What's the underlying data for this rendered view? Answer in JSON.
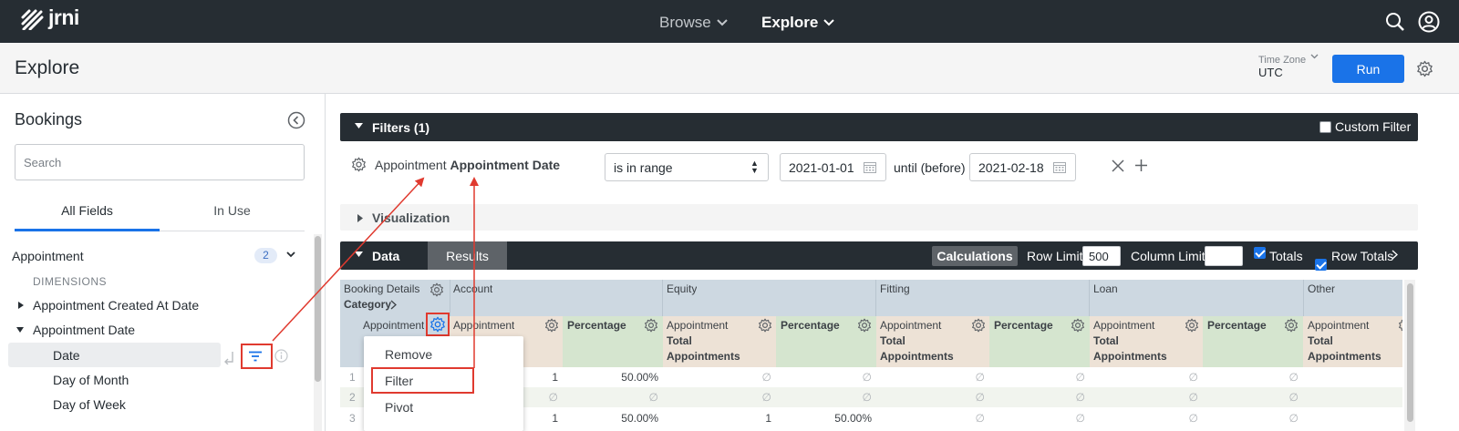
{
  "app": {
    "brand": "jrni",
    "nav": {
      "browse": "Browse",
      "explore": "Explore"
    }
  },
  "header": {
    "title": "Explore",
    "timezone_label": "Time Zone",
    "timezone_value": "UTC",
    "run_label": "Run"
  },
  "sidebar": {
    "title": "Bookings",
    "search_placeholder": "Search",
    "tabs": [
      "All Fields",
      "In Use"
    ],
    "group": {
      "name": "Appointment",
      "count": "2"
    },
    "dimensions_label": "DIMENSIONS",
    "fields": [
      "Appointment Created At Date",
      "Appointment Date",
      "Date",
      "Day of Month",
      "Day of Week"
    ]
  },
  "filters": {
    "title": "Filters (1)",
    "custom_filter_label": "Custom Filter",
    "field_prefix": "Appointment",
    "field_name": "Appointment Date",
    "operator": "is in range",
    "from_date": "2021-01-01",
    "until_label": "until (before)",
    "to_date": "2021-02-18"
  },
  "visualization": {
    "title": "Visualization"
  },
  "data": {
    "title": "Data",
    "results_tab": "Results",
    "calculations_label": "Calculations",
    "row_limit_label": "Row Limit",
    "row_limit_value": "500",
    "column_limit_label": "Column Limit",
    "totals_label": "Totals",
    "row_totals_label": "Row Totals"
  },
  "table": {
    "pivot_header": {
      "line1": "Booking Details",
      "line2": "Category"
    },
    "pivot_values": [
      "Account",
      "Equity",
      "Fitting",
      "Loan",
      "Other"
    ],
    "dimension_col": "Appointment",
    "measure_col": "Appointment Total Appointments",
    "measure_prefix": "Appointment",
    "measure_name": "Total Appointments",
    "pct_col": "Percentage",
    "rows": [
      {
        "num": "1",
        "account": "1",
        "account_pct": "50.00%",
        "equity": "∅",
        "equity_pct": "∅",
        "fitting": "∅",
        "fitting_pct": "∅",
        "loan": "∅",
        "loan_pct": "∅"
      },
      {
        "num": "2",
        "account": "∅",
        "account_pct": "∅",
        "equity": "∅",
        "equity_pct": "∅",
        "fitting": "∅",
        "fitting_pct": "∅",
        "loan": "∅",
        "loan_pct": "∅"
      },
      {
        "num": "3",
        "account": "1",
        "account_pct": "50.00%",
        "equity": "1",
        "equity_pct": "50.00%",
        "fitting": "∅",
        "fitting_pct": "∅",
        "loan": "∅",
        "loan_pct": "∅"
      }
    ]
  },
  "context_menu": {
    "items": [
      "Remove",
      "Filter",
      "Pivot"
    ]
  },
  "colors": {
    "accent": "#1a73e8",
    "topbar": "#262d33",
    "annotation": "#e03a2f"
  }
}
